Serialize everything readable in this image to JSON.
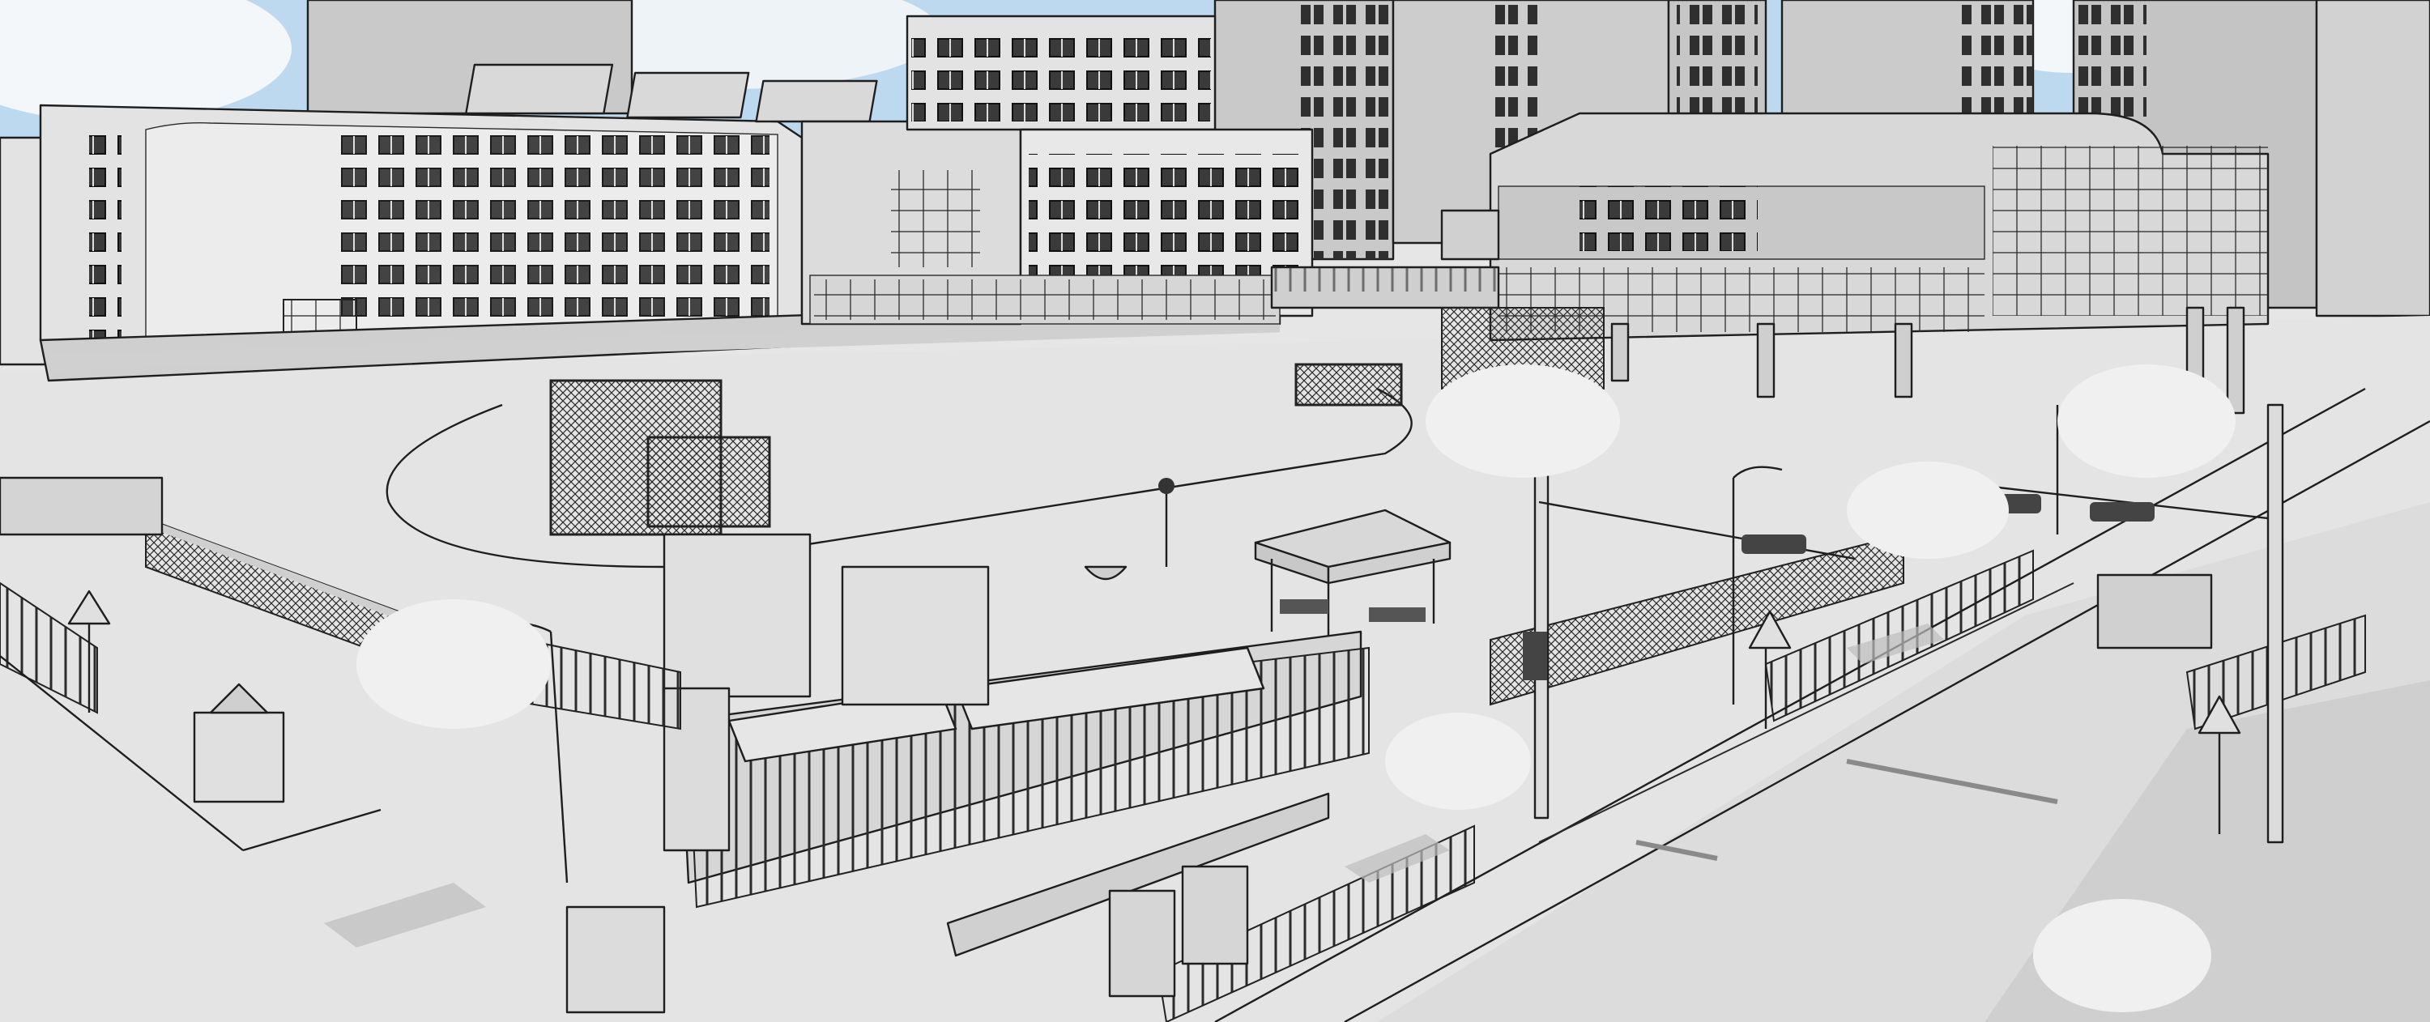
{
  "colors": {
    "sky": "#bcd9ef",
    "cloud": "#f4f7fa",
    "ground": "#e4e4e4",
    "wall": "#e3e3e3",
    "wall_shade": "#cfcfcf",
    "tower": "#c9c9c9",
    "roof": "#d8d8d8",
    "ink": "#1e1e1e",
    "shadow": "#bdbdbd",
    "tree": "#f0f0f0"
  },
  "icons": {
    "warning_sign": "triangle-road-sign",
    "traffic_light": "traffic-light",
    "street_lamp": "street-lamp"
  }
}
